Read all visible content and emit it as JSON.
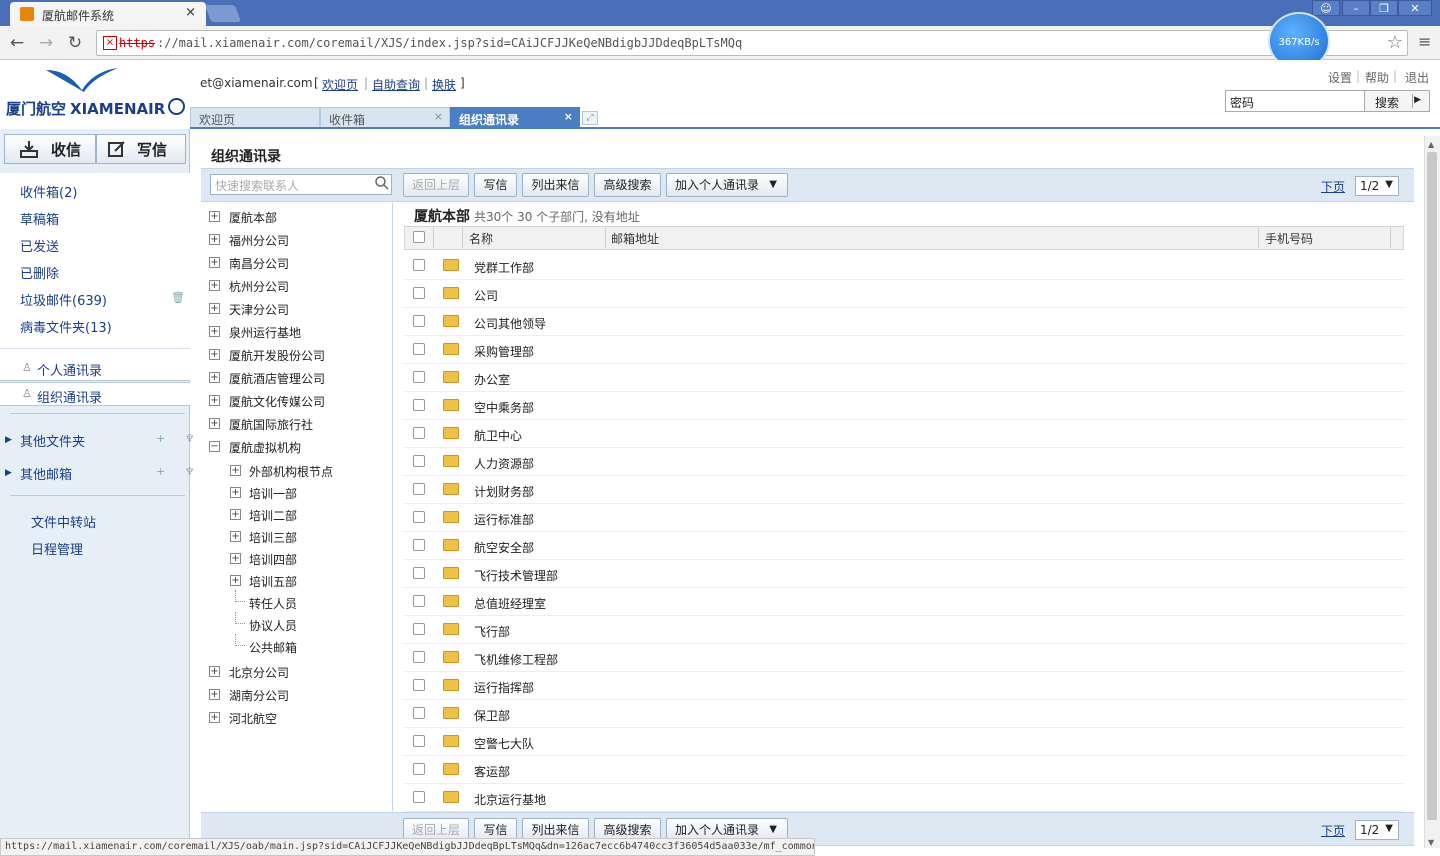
{
  "browser": {
    "tab_title": "厦航邮件系统",
    "url_protocol": "https",
    "url_rest": "://mail.xiamenair.com/coremail/XJS/index.jsp?sid=CAiJCFJJKeQeNBdigbJJDdeqBpLTsMQq",
    "speed": "367KB/s",
    "status_url": "https://mail.xiamenair.com/coremail/XJS/oab/main.jsp?sid=CAiJCFJJKeQeNBdigbJJDdeqBpLTsMQq&dn=126ac7ecc6b4740cc3f36054d5aa033e/mf_common"
  },
  "header": {
    "logo_text_cn": "厦门航空",
    "logo_text_en": "XIAMENAIR",
    "user_email": "et@xiamenair.com",
    "bracket_open": "[",
    "bracket_close": "]",
    "links": [
      "欢迎页",
      "自助查询",
      "换肤"
    ],
    "top_links": [
      "设置",
      "帮助",
      "退出"
    ],
    "search_value": "密码",
    "search_button": "搜索"
  },
  "app_tabs": [
    "欢迎页",
    "收件箱",
    "组织通讯录"
  ],
  "sidebar": {
    "receive": "收信",
    "compose": "写信",
    "folders": [
      "收件箱(2)",
      "草稿箱",
      "已发送",
      "已删除",
      "垃圾邮件(639)",
      "病毒文件夹(13)"
    ],
    "personal_contacts": "个人通讯录",
    "org_contacts": "组织通讯录",
    "other_folders": "其他文件夹",
    "other_mailboxes": "其他邮箱",
    "tools": [
      "文件中转站",
      "日程管理"
    ]
  },
  "main": {
    "title": "组织通讯录",
    "search_placeholder": "快速搜索联系人",
    "buttons": [
      "返回上层",
      "写信",
      "列出来信",
      "高级搜索",
      "加入个人通讯录"
    ],
    "next_page": "下页",
    "page_select": "1/2",
    "list_title": "厦航本部",
    "list_info": "共30个 30 个子部门, 没有地址",
    "columns": [
      "名称",
      "邮箱地址",
      "手机号码"
    ],
    "rows": [
      "党群工作部",
      "公司",
      "公司其他领导",
      "采购管理部",
      "办公室",
      "空中乘务部",
      "航卫中心",
      "人力资源部",
      "计划财务部",
      "运行标准部",
      "航空安全部",
      "飞行技术管理部",
      "总值班经理室",
      "飞行部",
      "飞机维修工程部",
      "运行指挥部",
      "保卫部",
      "空警七大队",
      "客运部",
      "北京运行基地"
    ]
  },
  "tree": {
    "top": [
      "厦航本部",
      "福州分公司",
      "南昌分公司",
      "杭州分公司",
      "天津分公司",
      "泉州运行基地",
      "厦航开发股份公司",
      "厦航酒店管理公司",
      "厦航文化传媒公司",
      "厦航国际旅行社",
      "厦航虚拟机构"
    ],
    "virtual_children": [
      "外部机构根节点",
      "培训一部",
      "培训二部",
      "培训三部",
      "培训四部",
      "培训五部",
      "转任人员",
      "协议人员",
      "公共邮箱"
    ],
    "bottom": [
      "北京分公司",
      "湖南分公司",
      "河北航空"
    ]
  }
}
